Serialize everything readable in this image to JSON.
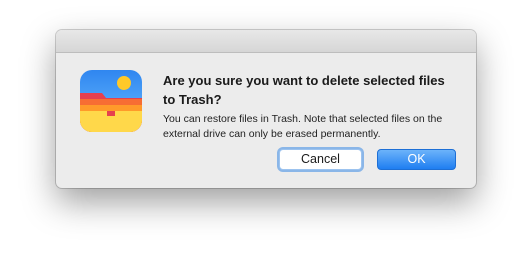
{
  "dialog": {
    "title": "Are you sure you want to delete selected files to Trash?",
    "message": "You can restore files in Trash.  Note that selected files on the external drive can only be erased permanently.",
    "icon": "app-folder-icon"
  },
  "buttons": {
    "cancel_label": "Cancel",
    "ok_label": "OK"
  },
  "colors": {
    "dialog_background": "#ececec",
    "default_button": "#1f7ef1",
    "focus_ring": "#8ab6e8"
  }
}
